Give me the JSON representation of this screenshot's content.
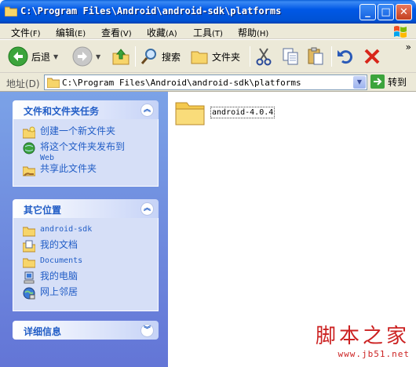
{
  "window": {
    "title": "C:\\Program Files\\Android\\android-sdk\\platforms",
    "minimize": "_",
    "maximize": "□",
    "close": "✕"
  },
  "menu": {
    "items": [
      {
        "label": "文件",
        "key": "(F)"
      },
      {
        "label": "编辑",
        "key": "(E)"
      },
      {
        "label": "查看",
        "key": "(V)"
      },
      {
        "label": "收藏",
        "key": "(A)"
      },
      {
        "label": "工具",
        "key": "(T)"
      },
      {
        "label": "帮助",
        "key": "(H)"
      }
    ]
  },
  "toolbar": {
    "back_label": "后退",
    "search_label": "搜索",
    "folders_label": "文件夹",
    "overflow": "»"
  },
  "address": {
    "label": "地址(D)",
    "value": "C:\\Program Files\\Android\\android-sdk\\platforms",
    "go_label": "转到"
  },
  "tasks_panel": {
    "title": "文件和文件夹任务",
    "items": [
      {
        "label": "创建一个新文件夹",
        "icon": "new-folder-icon"
      },
      {
        "label": "将这个文件夹发布到",
        "sub": "Web",
        "icon": "publish-web-icon"
      },
      {
        "label": "共享此文件夹",
        "icon": "share-folder-icon"
      }
    ]
  },
  "places_panel": {
    "title": "其它位置",
    "items": [
      {
        "label": "android-sdk",
        "icon": "folder-icon"
      },
      {
        "label": "我的文档",
        "icon": "my-documents-icon"
      },
      {
        "label": "Documents",
        "icon": "folder-icon"
      },
      {
        "label": "我的电脑",
        "icon": "my-computer-icon"
      },
      {
        "label": "网上邻居",
        "icon": "network-icon"
      }
    ]
  },
  "details_panel": {
    "title": "详细信息"
  },
  "files": [
    {
      "name": "android-4.0.4",
      "type": "folder"
    }
  ],
  "watermark": {
    "main": "脚本之家",
    "url": "www.jb51.net"
  },
  "colors": {
    "titlebar": "#0058e6",
    "pane": "#7ba2e7",
    "link": "#215dc6",
    "watermark": "#cc2222"
  }
}
